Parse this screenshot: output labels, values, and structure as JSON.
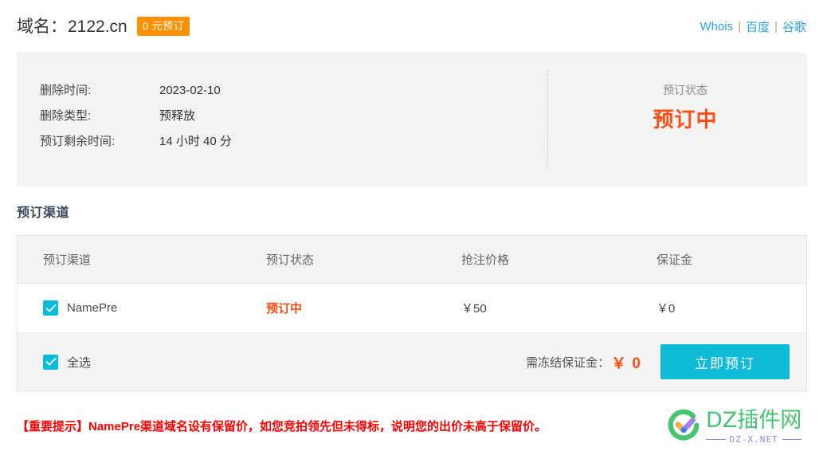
{
  "header": {
    "domain_label": "域名：",
    "domain_name": "2122.cn",
    "badge": "0 元预订",
    "links": [
      {
        "label": "Whois"
      },
      {
        "label": "百度"
      },
      {
        "label": "谷歌"
      }
    ],
    "separator": "|",
    "link_color": "#29a3e0",
    "badge_color": "#ff9000"
  },
  "info": {
    "rows": [
      {
        "key": "删除时间:",
        "value": "2023-02-10"
      },
      {
        "key": "删除类型:",
        "value": "预释放"
      },
      {
        "key": "预订剩余时间:",
        "value": "14 小时 40 分"
      }
    ],
    "status_label": "预订状态",
    "status_value": "预订中",
    "status_color": "#ff4d11"
  },
  "section": {
    "title": "预订渠道"
  },
  "table": {
    "columns": [
      "预订渠道",
      "预订状态",
      "抢注价格",
      "保证金"
    ],
    "rows": [
      {
        "checked": true,
        "checkbox_icon": "check-icon",
        "channel": "NamePre",
        "status": "预订中",
        "price": "￥50",
        "deposit": "￥0"
      }
    ],
    "footer": {
      "select_all_label": "全选",
      "select_all_checked": true,
      "deposit_label": "需冻结保证金：",
      "deposit_amount": "￥ 0",
      "button_label": "立即预订",
      "button_color": "#0ebcd7",
      "checkbox_color": "#08bdd9"
    }
  },
  "warning": {
    "text": "【重要提示】NamePre渠道域名设有保留价，如您竞拍领先但未得标，说明您的出价未高于保留价。",
    "color": "#fe0000"
  },
  "watermark": {
    "title": "DZ插件网",
    "subtitle": "DZ-X.NET",
    "title_color": "#3fc56a",
    "subtitle_color": "#8f7fe0"
  }
}
